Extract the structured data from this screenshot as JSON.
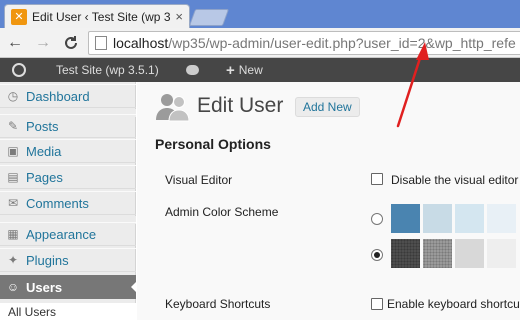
{
  "browser": {
    "tab_title": "Edit User ‹ Test Site (wp 3.",
    "tab_close": "×",
    "back_glyph": "←",
    "forward_glyph": "→",
    "reload_glyph": "C",
    "url_host": "localhost",
    "url_path": "/wp35/wp-admin/user-edit.php?user_id=2&wp_http_refe"
  },
  "adminbar": {
    "site_name": "Test Site (wp 3.5.1)",
    "new_label": "New",
    "plus_glyph": "+"
  },
  "sidebar": {
    "items": [
      {
        "label": "Dashboard",
        "icon": "dashboard-icon",
        "glyph": "◷"
      },
      {
        "label": "Posts",
        "icon": "posts-pin-icon",
        "glyph": "✎"
      },
      {
        "label": "Media",
        "icon": "media-icon",
        "glyph": "▣"
      },
      {
        "label": "Pages",
        "icon": "pages-icon",
        "glyph": "▤"
      },
      {
        "label": "Comments",
        "icon": "comments-icon",
        "glyph": "✉"
      },
      {
        "label": "Appearance",
        "icon": "appearance-icon",
        "glyph": "▦"
      },
      {
        "label": "Plugins",
        "icon": "plugins-icon",
        "glyph": "✦"
      },
      {
        "label": "Users",
        "icon": "users-icon",
        "glyph": "☺"
      }
    ],
    "submenu": {
      "label": "All Users"
    }
  },
  "page": {
    "title": "Edit User",
    "add_new": "Add New",
    "section_title": "Personal Options",
    "visual_editor_label": "Visual Editor",
    "visual_editor_checkbox": "Disable the visual editor w",
    "color_scheme_label": "Admin Color Scheme",
    "keyboard_label": "Keyboard Shortcuts",
    "keyboard_checkbox": "Enable keyboard shortcuts"
  },
  "color_schemes": {
    "blue": [
      "#4a84b0",
      "#c8dbe6",
      "#d4e6f0",
      "#e8f0f6"
    ],
    "gray": [
      "#4e4e4e",
      "#9a9a9a",
      "#d8d8d8",
      "#eeeeee"
    ],
    "selected": "gray"
  },
  "annotation_color": "#e02020"
}
